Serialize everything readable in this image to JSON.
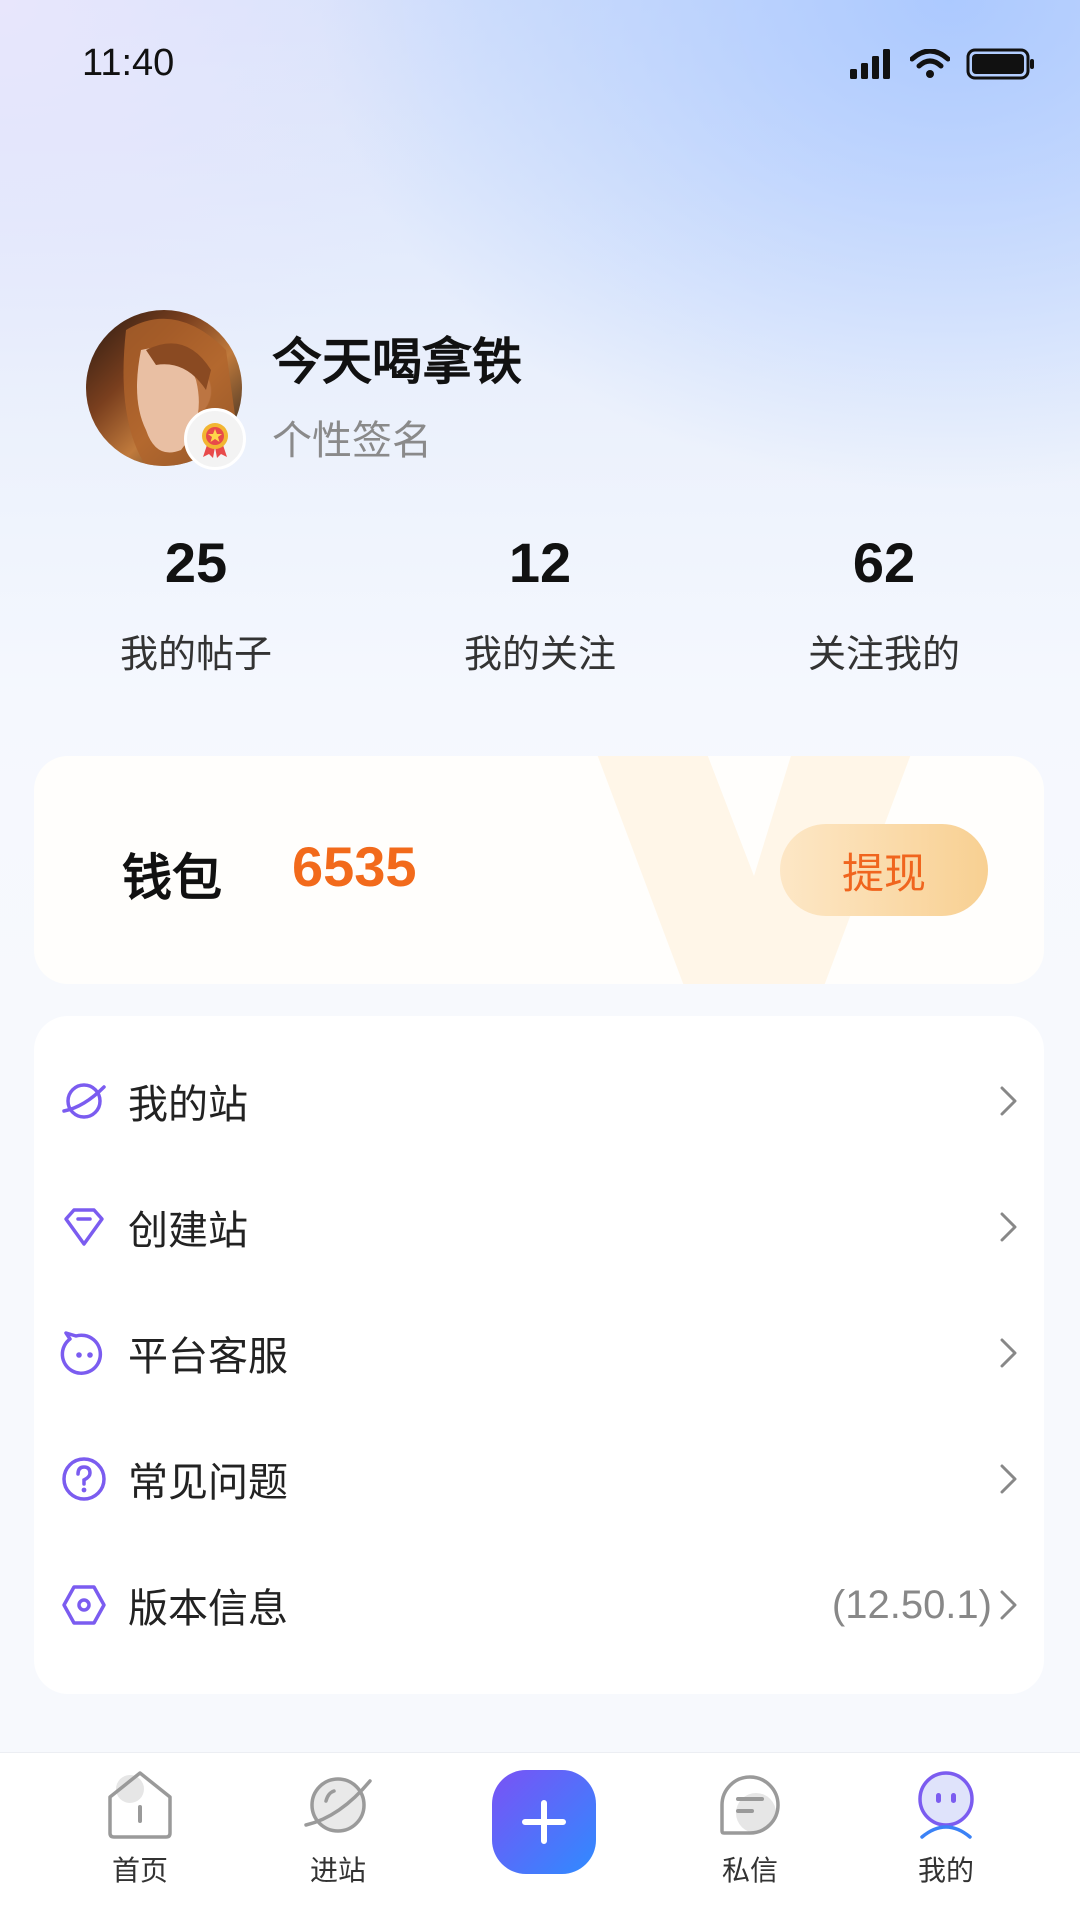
{
  "status_bar": {
    "time": "11:40"
  },
  "profile": {
    "name": "今天喝拿铁",
    "signature": "个性签名"
  },
  "stats": [
    {
      "value": "25",
      "label": "我的帖子"
    },
    {
      "value": "12",
      "label": "我的关注"
    },
    {
      "value": "62",
      "label": "关注我的"
    }
  ],
  "wallet": {
    "title": "钱包",
    "value": "6535",
    "action": "提现"
  },
  "menu": {
    "items": [
      {
        "label": "我的站",
        "icon": "planet-icon"
      },
      {
        "label": "创建站",
        "icon": "diamond-icon"
      },
      {
        "label": "平台客服",
        "icon": "service-face-icon"
      },
      {
        "label": "常见问题",
        "icon": "question-icon"
      },
      {
        "label": "版本信息",
        "icon": "hexagon-icon",
        "value": "(12.50.1)"
      }
    ]
  },
  "tabbar": {
    "items": [
      {
        "label": "首页",
        "icon": "home-icon"
      },
      {
        "label": "进站",
        "icon": "planet-icon"
      },
      {
        "label": "私信",
        "icon": "message-icon"
      },
      {
        "label": "我的",
        "icon": "profile-icon",
        "active": true
      }
    ],
    "add_icon": "plus-icon"
  },
  "colors": {
    "accent_purple": "#7b5cf0",
    "wallet_orange": "#f26a1b",
    "tab_active_blue": "#3b82f6"
  }
}
